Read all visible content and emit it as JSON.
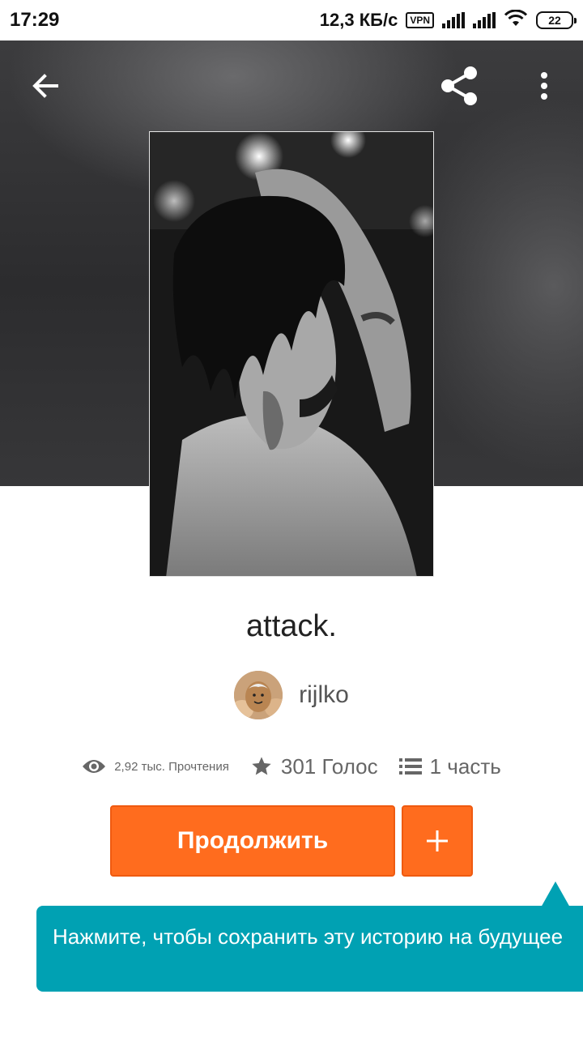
{
  "status_bar": {
    "time": "17:29",
    "network_speed": "12,3 КБ/с",
    "vpn_label": "VPN",
    "battery_level": "22"
  },
  "toolbar": {
    "back_icon": "arrow-left-icon",
    "share_icon": "share-icon",
    "more_icon": "more-vertical-icon"
  },
  "story": {
    "title": "attack.",
    "author": "rijlko",
    "reads": "2,92 тыс. Прочтения",
    "votes": "301 Голос",
    "parts": "1 часть"
  },
  "actions": {
    "continue_label": "Продолжить",
    "add_icon": "plus-icon"
  },
  "tooltip": {
    "text": "Нажмите, чтобы сохранить эту историю на будущее"
  },
  "colors": {
    "accent_orange": "#ff6c1e",
    "tooltip_teal": "#00a1b3",
    "header_dark": "#2c2c2e"
  }
}
